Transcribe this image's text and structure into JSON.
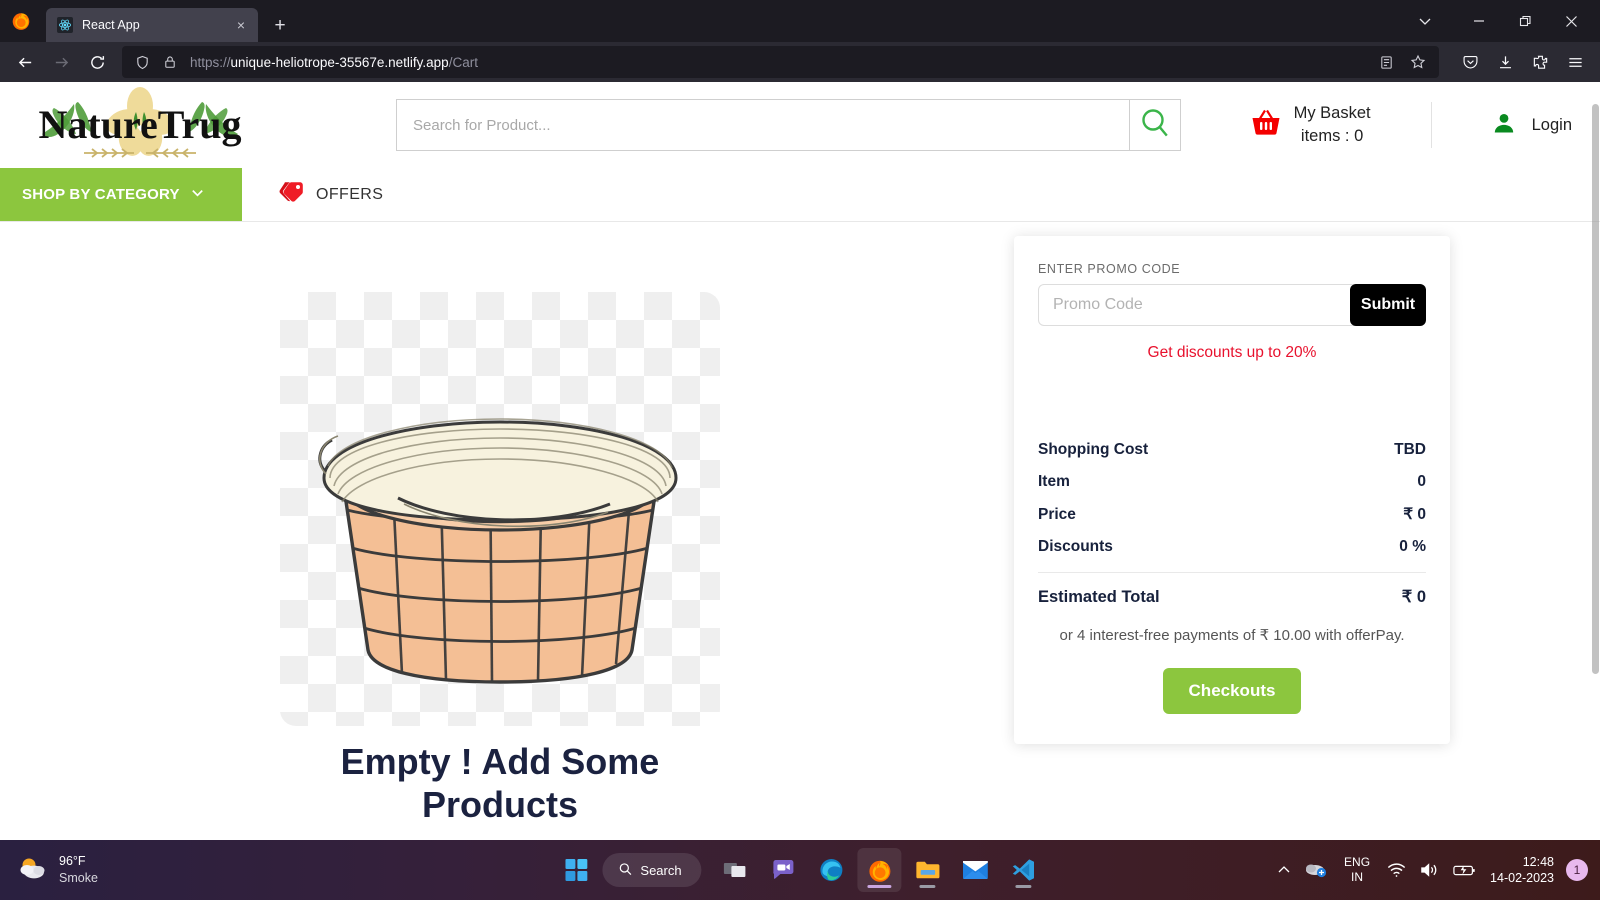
{
  "browser": {
    "tab": {
      "title": "React App",
      "favicon": "react-icon",
      "close_label": "×"
    },
    "new_tab_label": "+",
    "url_scheme": "https://",
    "url_host": "unique-heliotrope-35567e.netlify.app",
    "url_path": "/Cart",
    "window_controls": {
      "chevron": "⌄",
      "minimize": "—",
      "restore": "❐",
      "close": "✕"
    },
    "toolbar_icons": [
      "back-arrow",
      "forward-arrow",
      "reload",
      "shield",
      "lock",
      "reader-view",
      "bookmark-star",
      "pocket",
      "downloads",
      "extensions",
      "app-menu"
    ]
  },
  "site": {
    "logo_text": "NatureTrug",
    "search": {
      "placeholder": "Search for Product...",
      "value": "",
      "icon": "magnifier-icon"
    },
    "basket": {
      "icon": "basket-icon",
      "line1": "My Basket",
      "line2": "items : 0"
    },
    "account": {
      "icon": "person-icon",
      "label": "Login"
    },
    "nav": {
      "category_label": "SHOP BY CATEGORY",
      "category_caret": "∨",
      "offers_label": "OFFERS",
      "offers_icon": "price-tag-icon"
    },
    "colors": {
      "brand_green": "#8cc63e",
      "accent_red": "#e8112d",
      "dark_navy": "#17213c"
    }
  },
  "cart": {
    "empty_title": "Empty ! Add Some Products",
    "empty_image": "wicker-basket-illustration"
  },
  "summary": {
    "promo_label": "ENTER PROMO CODE",
    "promo_placeholder": "Promo Code",
    "promo_value": "",
    "submit_label": "Submit",
    "promo_note": "Get discounts up to 20%",
    "rows": [
      {
        "label": "Shopping Cost",
        "value": "TBD"
      },
      {
        "label": "Item",
        "value": "0"
      },
      {
        "label": "Price",
        "value": "₹ 0"
      },
      {
        "label": "Discounts",
        "value": "0 %"
      }
    ],
    "total": {
      "label": "Estimated Total",
      "value": "₹ 0"
    },
    "pay_note": "or 4 interest-free payments of ₹ 10.00 with offerPay.",
    "checkout_label": "Checkouts"
  },
  "taskbar": {
    "weather": {
      "temp": "96°F",
      "condition": "Smoke",
      "icon": "cloud-sun-icon"
    },
    "search_label": "Search",
    "apps": [
      "start-icon",
      "search-icon",
      "task-view-icon",
      "chat-icon",
      "edge-icon",
      "firefox-icon",
      "file-explorer-icon",
      "mail-icon",
      "vscode-icon"
    ],
    "tray": {
      "overflow": "∧",
      "language_line1": "ENG",
      "language_line2": "IN",
      "time": "12:48",
      "date": "14-02-2023",
      "notification_count": "1",
      "icons": [
        "overflow-chevron-icon",
        "onedrive-icon",
        "wifi-icon",
        "volume-icon",
        "battery-charging-icon"
      ]
    }
  }
}
